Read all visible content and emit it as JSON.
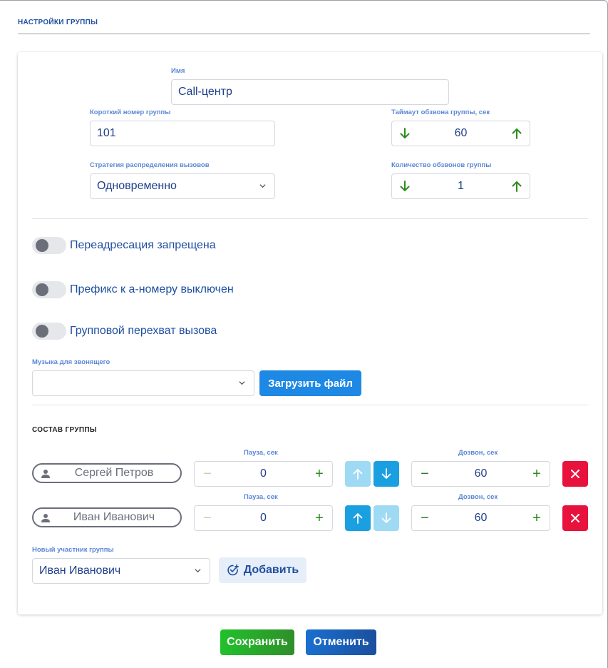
{
  "header": {
    "title": "НАСТРОЙКИ ГРУППЫ"
  },
  "form": {
    "name_label": "Имя",
    "name_value": "Call-центр",
    "short_number_label": "Короткий номер группы",
    "short_number_value": "101",
    "timeout_label": "Таймаут обзвона группы, сек",
    "timeout_value": "60",
    "strategy_label": "Стратегия распределения вызовов",
    "strategy_value": "Одновременно",
    "rounds_label": "Количество обзвонов группы",
    "rounds_value": "1"
  },
  "toggles": [
    {
      "label": "Переадресация запрещена",
      "on": false
    },
    {
      "label": "Префикс к а-номеру выключен",
      "on": false
    },
    {
      "label": "Групповой перехват вызова",
      "on": false
    }
  ],
  "music": {
    "label": "Музыка для звонящего",
    "value": "",
    "upload_label": "Загрузить файл"
  },
  "members": {
    "title": "СОСТАВ ГРУППЫ",
    "pause_label": "Пауза, сек",
    "dial_label": "Дозвон, сек",
    "rows": [
      {
        "name": "Сергей Петров",
        "pause": "0",
        "dial": "60"
      },
      {
        "name": "Иван Иванович",
        "pause": "0",
        "dial": "60"
      }
    ],
    "new_member_label": "Новый участник группы",
    "new_member_value": "Иван Иванович",
    "add_label": "Добавить"
  },
  "footer": {
    "save_label": "Сохранить",
    "cancel_label": "Отменить"
  },
  "colors": {
    "accent_blue": "#1e88e5",
    "label_blue": "#5b86d6",
    "text_blue": "#1f3f8a",
    "arrow_green": "#2e8b1e",
    "delete_red": "#e8133d",
    "save_green": "#21c12b",
    "cancel_blue": "#1b5cb4"
  }
}
